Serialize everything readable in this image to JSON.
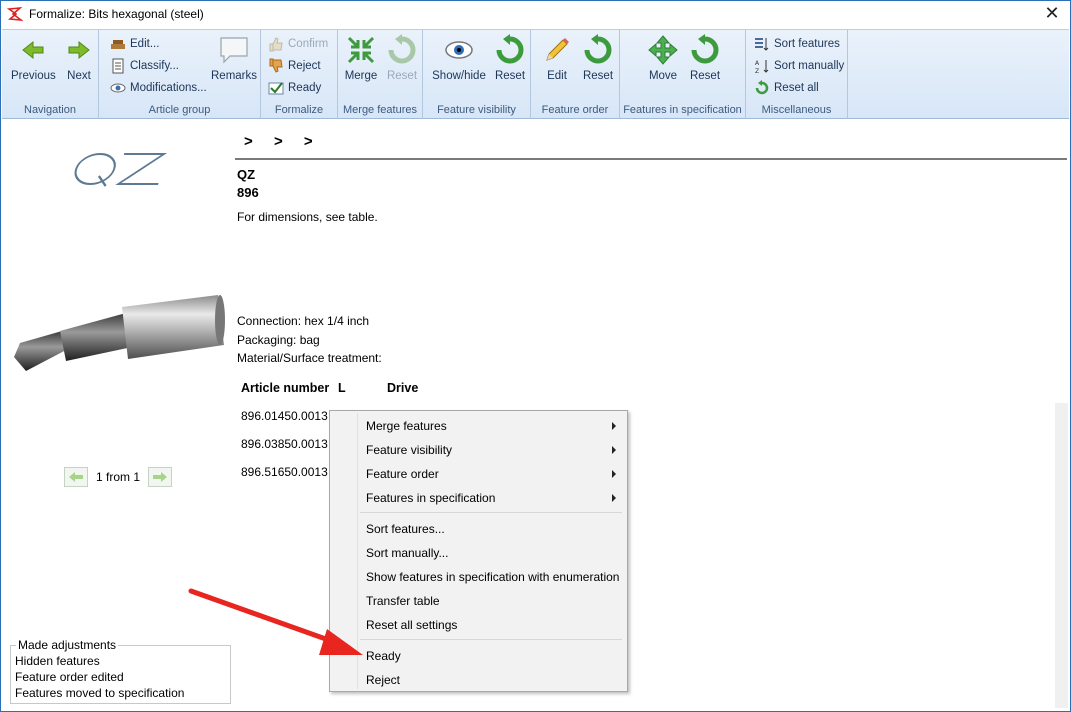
{
  "window": {
    "title": "Formalize: Bits hexagonal (steel)"
  },
  "ribbon": {
    "navigation": {
      "label": "Navigation",
      "previous": "Previous",
      "next": "Next"
    },
    "article_group": {
      "label": "Article group",
      "edit": "Edit...",
      "classify": "Classify...",
      "modifications": "Modifications...",
      "remarks": "Remarks"
    },
    "formalize": {
      "label": "Formalize",
      "confirm": "Confirm",
      "reject": "Reject",
      "ready": "Ready"
    },
    "merge_features": {
      "label": "Merge features",
      "merge": "Merge",
      "reset": "Reset"
    },
    "feature_visibility": {
      "label": "Feature visibility",
      "show_hide": "Show/hide",
      "reset": "Reset"
    },
    "feature_order": {
      "label": "Feature order",
      "edit": "Edit",
      "reset": "Reset"
    },
    "features_in_spec": {
      "label": "Features in specification",
      "move": "Move",
      "reset": "Reset"
    },
    "miscellaneous": {
      "label": "Miscellaneous",
      "sort_features": "Sort features",
      "sort_manually": "Sort manually",
      "reset_all": "Reset all"
    }
  },
  "content": {
    "breadcrumb": [
      ">",
      ">",
      ">"
    ],
    "brand": "QZ",
    "article_no": "896",
    "description": "For dimensions, see table.",
    "features": [
      "Connection: hex 1/4 inch",
      "Packaging: bag",
      "Material/Surface treatment:"
    ],
    "table": {
      "headers": [
        "Article number",
        "L",
        "Drive"
      ],
      "rows": [
        [
          "896.01450.0013"
        ],
        [
          "896.03850.0013"
        ],
        [
          "896.51650.0013"
        ]
      ]
    },
    "pager": {
      "text": "1 from 1"
    }
  },
  "adjustments": {
    "title": "Made adjustments",
    "items": [
      "Hidden features",
      "Feature order edited",
      "Features moved to specification"
    ]
  },
  "context_menu": {
    "items": [
      "Merge features",
      "Feature visibility",
      "Feature order",
      "Features in specification",
      "Sort features...",
      "Sort manually...",
      "Show features in specification with enumeration",
      "Transfer table",
      "Reset all settings",
      "Ready",
      "Reject"
    ]
  },
  "colors": {
    "accent": "#2b6fb6",
    "annotation_arrow": "#e8261f",
    "ribbon_bg": "#dde9f6"
  }
}
